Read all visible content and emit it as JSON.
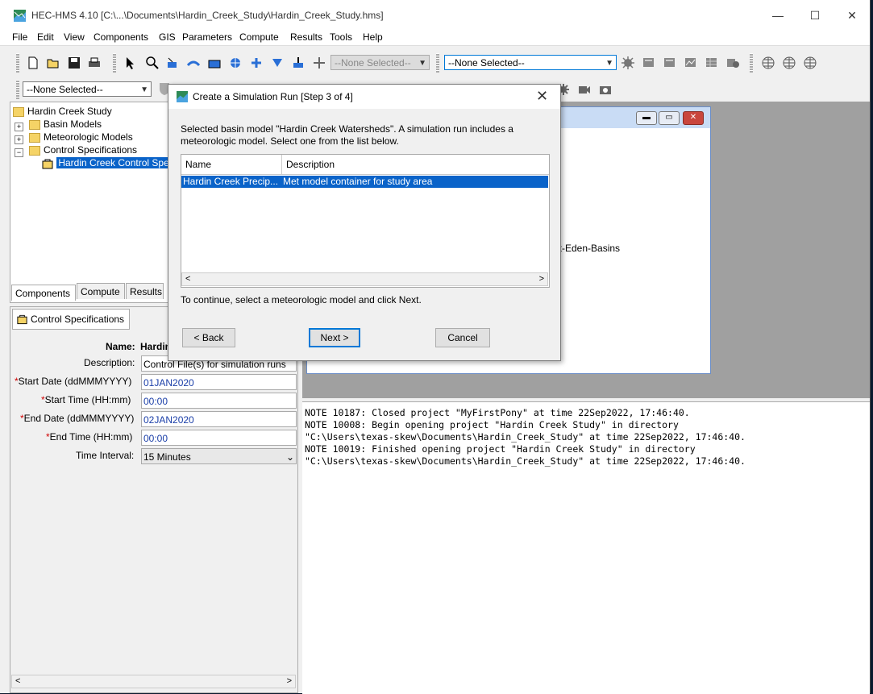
{
  "window": {
    "title": "HEC-HMS 4.10 [C:\\...\\Documents\\Hardin_Creek_Study\\Hardin_Creek_Study.hms]",
    "minimize": "—",
    "maximize": "☐",
    "close": "✕"
  },
  "menu": [
    "File",
    "Edit",
    "View",
    "Components",
    "GIS",
    "Parameters",
    "Compute",
    "Results",
    "Tools",
    "Help"
  ],
  "toolbar": {
    "combo1": "--None Selected--",
    "combo2": "--None Selected--",
    "combo3": "--None Selected--"
  },
  "tree": {
    "root": "Hardin Creek Study",
    "items": [
      "Basin Models",
      "Meteorologic Models",
      "Control Specifications"
    ],
    "selected": "Hardin Creek Control Spe"
  },
  "tabs": [
    "Components",
    "Compute",
    "Results"
  ],
  "props": {
    "header": "Control Specifications",
    "name_label": "Name:",
    "name_value": "Hardin",
    "description_label": "Description:",
    "description_value": "Control File(s) for simulation runs",
    "start_date_label": "Start Date (ddMMMYYYY)",
    "start_date_value": "01JAN2020",
    "start_time_label": "Start Time (HH:mm)",
    "start_time_value": "00:00",
    "end_date_label": "End Date (ddMMMYYYY)",
    "end_date_value": "02JAN2020",
    "end_time_label": "End Time (HH:mm)",
    "end_time_value": "00:00",
    "interval_label": "Time Interval:",
    "interval_value": "15 Minutes",
    "required_mark": "*"
  },
  "basin_fragment": "est-Eden-Basins",
  "console": [
    "NOTE 10187:  Closed project \"MyFirstPony\" at time 22Sep2022, 17:46:40.",
    "NOTE 10008:  Begin opening project \"Hardin Creek Study\" in directory",
    "\"C:\\Users\\texas-skew\\Documents\\Hardin_Creek_Study\" at time 22Sep2022, 17:46:40.",
    "NOTE 10019:  Finished opening project \"Hardin Creek Study\" in directory",
    "\"C:\\Users\\texas-skew\\Documents\\Hardin_Creek_Study\" at time 22Sep2022, 17:46:40."
  ],
  "dialog": {
    "title": "Create a Simulation Run [Step 3 of 4]",
    "message": "Selected basin model \"Hardin Creek Watersheds\". A simulation run includes a meteorologic model. Select one from the list below.",
    "col_name": "Name",
    "col_description": "Description",
    "row_name": "Hardin Creek Precip...",
    "row_description": "Met model container for study area",
    "footer": "To continue, select a meteorologic model and click Next.",
    "back": "< Back",
    "next": "Next >",
    "cancel": "Cancel"
  },
  "colors": {
    "selection": "#0a63c9",
    "required": "#d00000",
    "field_blue": "#1a3ea8"
  }
}
